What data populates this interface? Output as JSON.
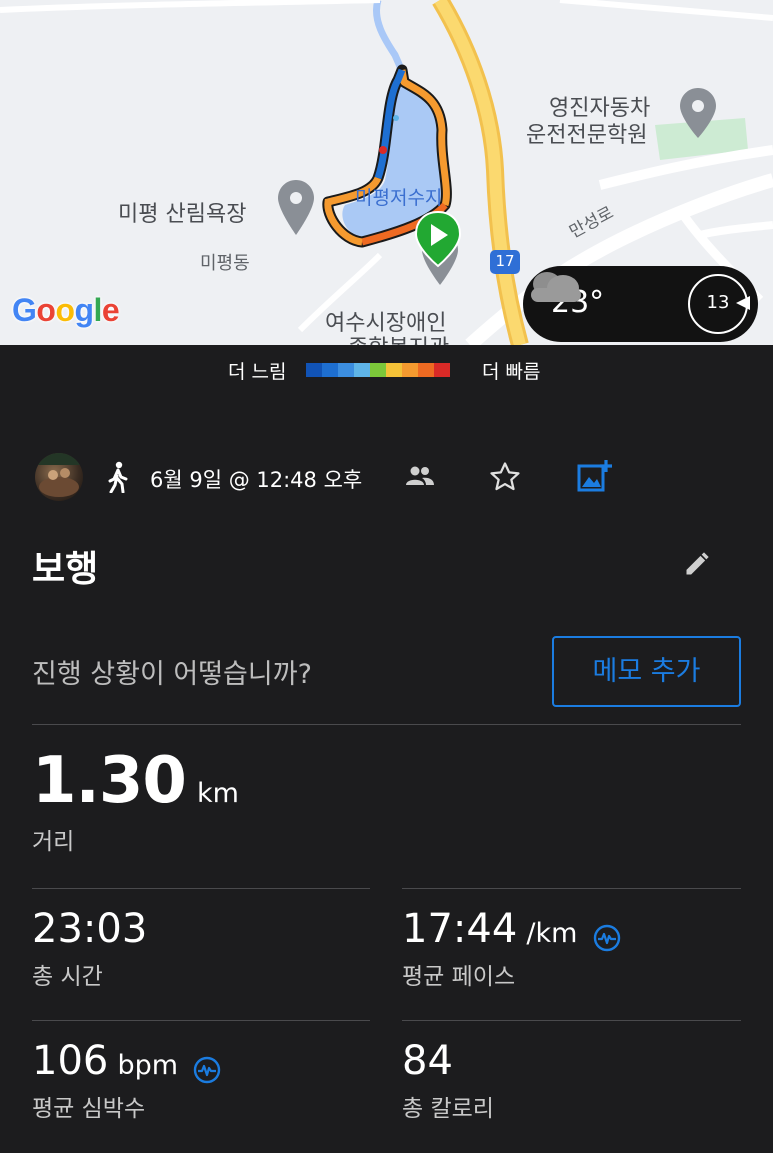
{
  "map": {
    "labels": {
      "driving_school": [
        "영진자동차",
        "운전전문학원"
      ],
      "beach": "미평 산림욕장",
      "reservoir": "미평저수지",
      "dong": "미평동",
      "road": "만성로",
      "route_number": "17",
      "welfare": [
        "여수시장애인",
        "종합복지관"
      ]
    },
    "google_logo": [
      "G",
      "o",
      "o",
      "g",
      "l",
      "e"
    ],
    "weather": {
      "temperature": "23°",
      "wind_value": "13",
      "condition_icon": "cloud-icon"
    }
  },
  "legend": {
    "slow_label": "더 느림",
    "fast_label": "더 빠름",
    "colors": [
      "#1153b6",
      "#1e6fd1",
      "#3c8ee0",
      "#5fb5e8",
      "#7cc83a",
      "#f4c238",
      "#f59a2f",
      "#ee6a22",
      "#d92a27"
    ]
  },
  "activity": {
    "date_time": "6월 9일 @ 12:48 오후",
    "type_icon": "walk-icon",
    "title": "보행",
    "question": "진행 상황이 어떻습니까?",
    "memo_button": "메모 추가"
  },
  "stats": {
    "distance": {
      "value": "1.30",
      "unit": "km",
      "label": "거리"
    },
    "total_time": {
      "value": "23:03",
      "label": "총 시간"
    },
    "avg_pace": {
      "value": "17:44",
      "unit": "/km",
      "label": "평균 페이스"
    },
    "avg_hr": {
      "value": "106",
      "unit": "bpm",
      "label": "평균 심박수"
    },
    "calories": {
      "value": "84",
      "label": "총 칼로리"
    }
  },
  "colors": {
    "accent": "#1b7ce0",
    "background": "#1c1c1e",
    "start_marker": "#22a832"
  }
}
